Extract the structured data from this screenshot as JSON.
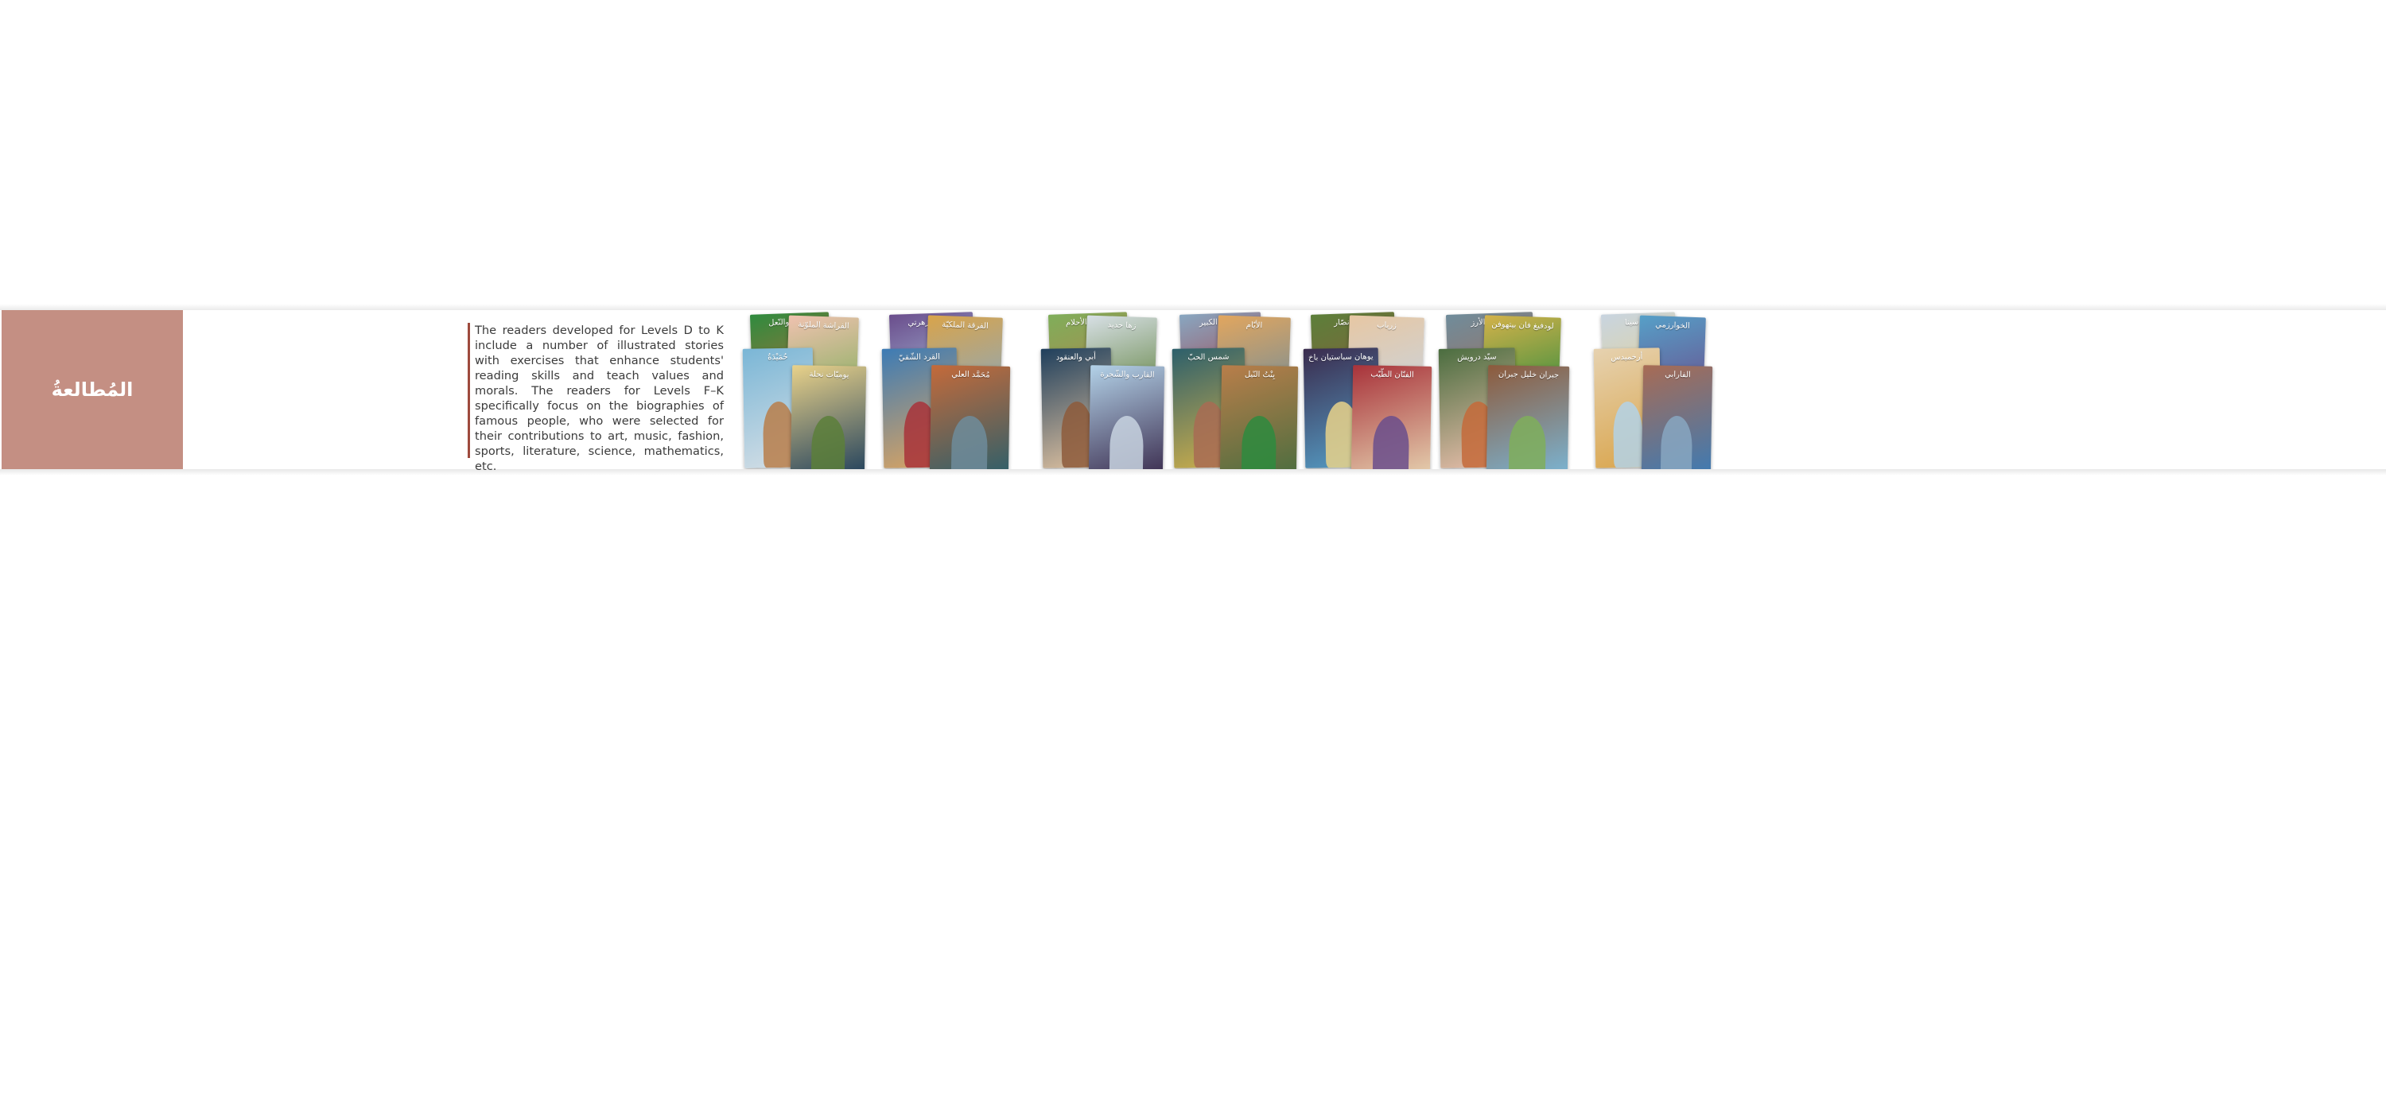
{
  "section": {
    "title": "المُطالعةُ",
    "title_bg": "#c48f83",
    "description": "The readers developed for Levels D to K include a number of illustrated stories with exercises that enhance students' reading skills and teach values and morals. The readers for Levels F–K specifically focus on the biographies of famous people, who were selected for their contributions to art, music, fashion, sports, literature, science, mathematics, etc.",
    "accent_color": "#9e4a3d"
  },
  "books_image": {
    "alt": "covers-collage",
    "cover_titles": [
      "النّحلة والنّعل",
      "الفراشة الملوّنة",
      "حُمَيْدَةُ",
      "يوميّات نحلة",
      "النّحلة وزهرتي",
      "الفرقة الملكيّة",
      "القرد الشّقيّ",
      "مُحَمَّد العلي",
      "مشرّع الأحلام",
      "زها حديد",
      "أبي والعنقود",
      "القارب والشّجرة",
      "شوقي الكبير",
      "الأيّام",
      "شمس الحبّ",
      "بِنْتُ النّيل",
      "سلوى نصّار",
      "زرياب",
      "يوهان سباستيان باخ",
      "الفنّان الطّيّب",
      "شجرة الأرز",
      "لودفيغ فان بيتهوفن",
      "سيّد درويش",
      "جبران خليل جبران",
      "ابن سينا",
      "الخوارزمي",
      "أرخميدس",
      "الفارابي"
    ]
  }
}
